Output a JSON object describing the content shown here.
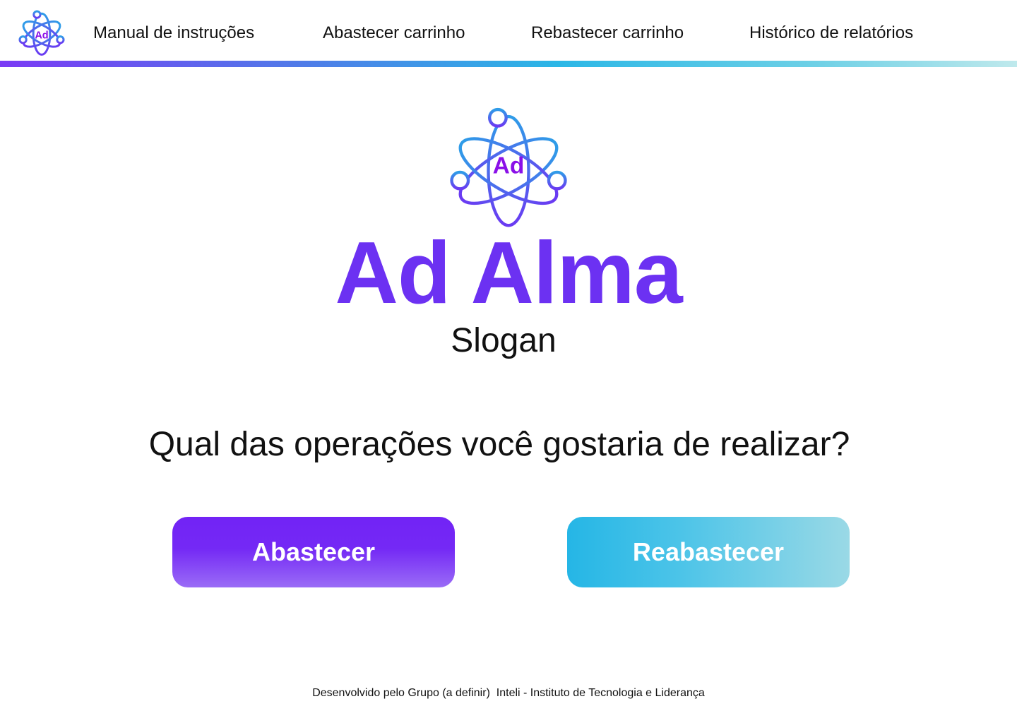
{
  "header": {
    "logo_icon": "atom-ad-logo-icon",
    "logo_text": "Ad",
    "nav": [
      {
        "label": "Manual de instruções"
      },
      {
        "label": "Abastecer carrinho"
      },
      {
        "label": "Rebastecer carrinho"
      },
      {
        "label": "Histórico de relatórios"
      }
    ]
  },
  "hero": {
    "logo_icon": "atom-ad-logo-icon",
    "logo_text": "Ad",
    "brand_name": "Ad Alma",
    "slogan": "Slogan"
  },
  "main": {
    "question": "Qual das operações você gostaria de realizar?",
    "buttons": {
      "abastecer": "Abastecer",
      "reabastecer": "Reabastecer"
    }
  },
  "footer": {
    "text": "Desenvolvido pelo Grupo (a definir)  Inteli - Instituto de Tecnologia e Liderança"
  },
  "colors": {
    "brand_purple": "#6c31f2",
    "button_purple": "#7223f5",
    "button_cyan": "#25b6e6",
    "logo_gradient_start": "#2f9ce8",
    "logo_gradient_end": "#6a3af2"
  }
}
